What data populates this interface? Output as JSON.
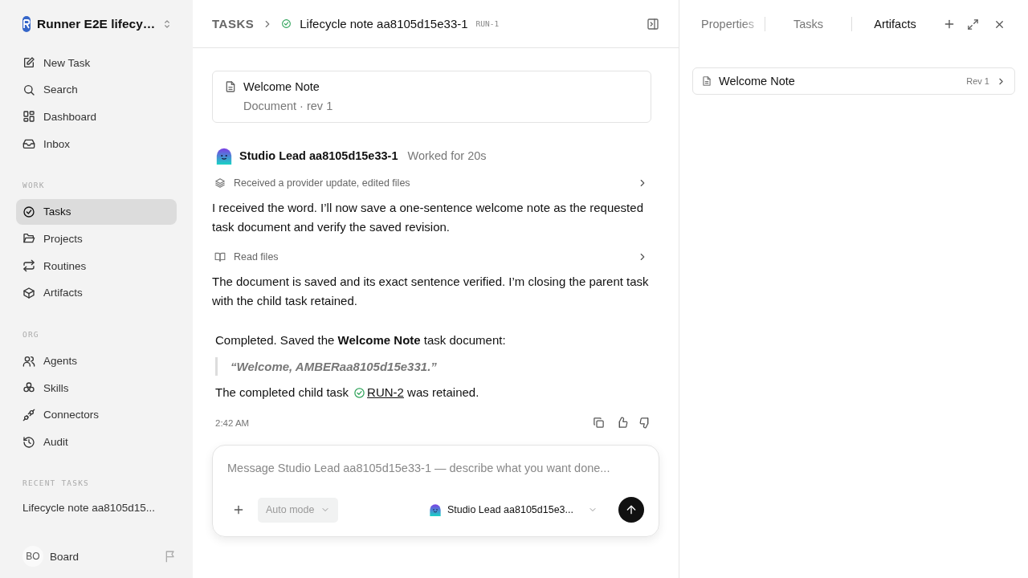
{
  "workspace": {
    "name": "Runner E2E lifecy…"
  },
  "sidebar": {
    "nav": [
      {
        "label": "New Task"
      },
      {
        "label": "Search"
      },
      {
        "label": "Dashboard"
      },
      {
        "label": "Inbox"
      }
    ],
    "sections": [
      {
        "title": "WORK",
        "items": [
          {
            "label": "Tasks",
            "selected": true
          },
          {
            "label": "Projects",
            "selected": false
          },
          {
            "label": "Routines",
            "selected": false
          },
          {
            "label": "Artifacts",
            "selected": false
          }
        ]
      },
      {
        "title": "ORG",
        "items": [
          {
            "label": "Agents",
            "selected": false
          },
          {
            "label": "Skills",
            "selected": false
          },
          {
            "label": "Connectors",
            "selected": false
          },
          {
            "label": "Audit",
            "selected": false
          }
        ]
      }
    ],
    "recent": {
      "title": "RECENT TASKS",
      "items": [
        "Lifecycle note aa8105d15..."
      ]
    },
    "user": {
      "initials": "BO",
      "name": "Board"
    }
  },
  "header": {
    "crumb": "TASKS",
    "title": "Lifecycle note aa8105d15e33-1",
    "id": "RUN-1",
    "done": true
  },
  "document_card": {
    "title": "Welcome Note",
    "meta": "Document · rev 1"
  },
  "message": {
    "author": "Studio Lead aa8105d15e33-1",
    "worked": "Worked for 20s",
    "blocks": [
      {
        "kind": "activity",
        "label": "Received a provider update, edited files"
      },
      {
        "kind": "text",
        "text": "I received the word. I’ll now save a one-sentence welcome note as the requested task document and verify the saved revision."
      },
      {
        "kind": "activity",
        "label": "Read files"
      },
      {
        "kind": "text",
        "text": "The document is saved and its exact sentence verified. I’m closing the parent task with the child task retained."
      }
    ],
    "summary": {
      "text": "Completed. Saved the **Welcome Note** task document:",
      "quote": "“Welcome, AMBERaa8105d15e331.”",
      "before": "The completed child task",
      "link": "RUN-2",
      "after": "was retained.",
      "done": true
    },
    "time": "2:42 AM"
  },
  "composer": {
    "placeholder": "Message Studio Lead aa8105d15e33-1 — describe what you want done...",
    "mode": "Auto mode",
    "agent": "Studio Lead aa8105d15e3..."
  },
  "panel": {
    "tabs": [
      {
        "label": "Properties",
        "selected": false
      },
      {
        "label": "Tasks",
        "selected": false
      },
      {
        "label": "Artifacts",
        "selected": true
      }
    ],
    "artifacts": [
      {
        "title": "Welcome Note",
        "rev": "Rev 1"
      }
    ]
  }
}
